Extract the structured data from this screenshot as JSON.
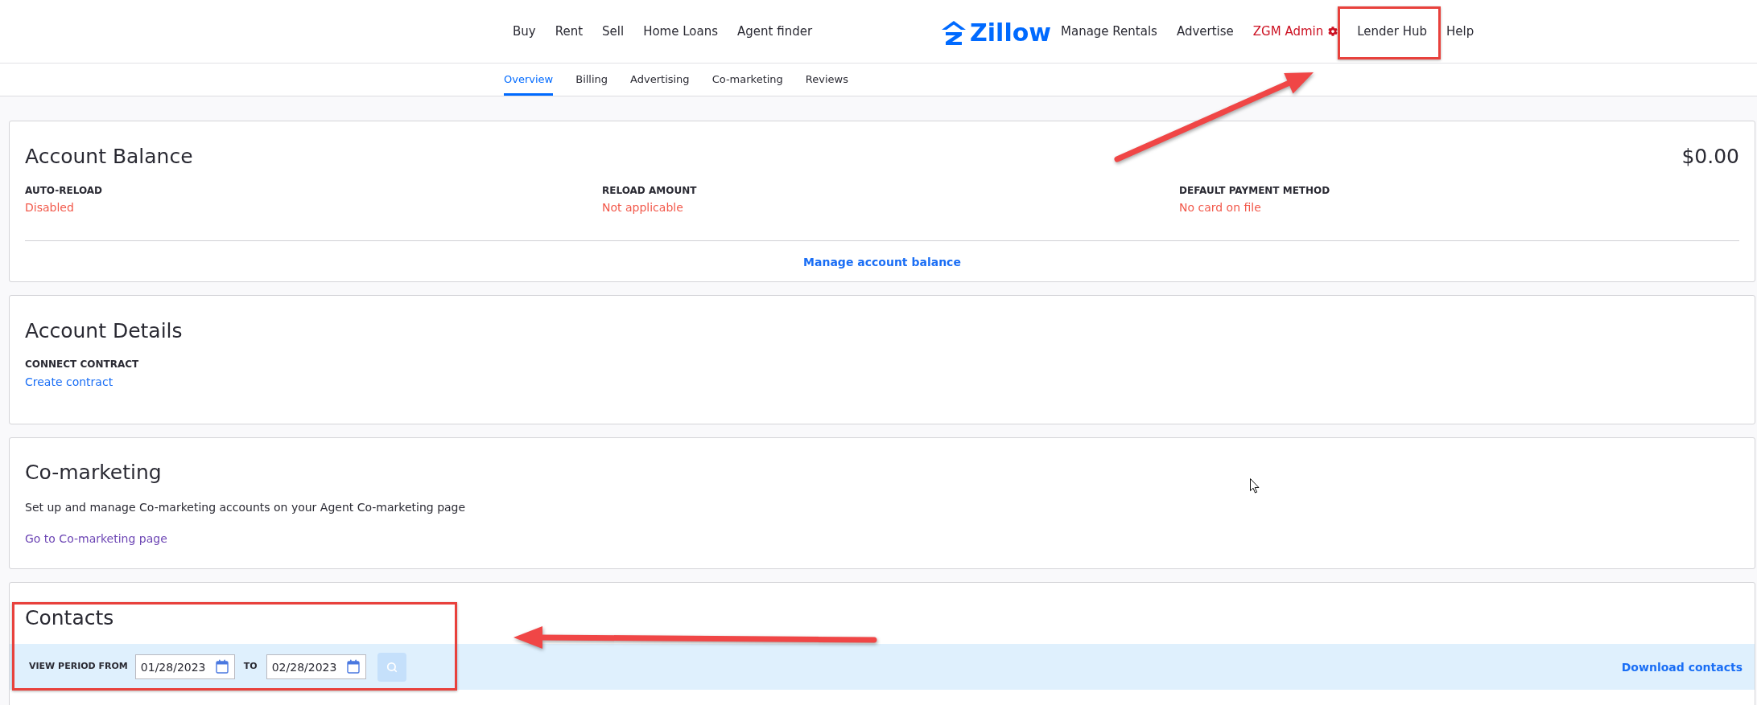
{
  "header": {
    "nav_left": [
      {
        "label": "Buy",
        "kind": "link",
        "highlighted": false
      },
      {
        "label": "Rent",
        "kind": "link",
        "highlighted": false
      },
      {
        "label": "Sell",
        "kind": "link",
        "highlighted": false
      },
      {
        "label": "Home Loans",
        "kind": "link",
        "highlighted": false
      },
      {
        "label": "Agent finder",
        "kind": "link",
        "highlighted": false
      }
    ],
    "logo": {
      "text": "Zillow"
    },
    "nav_right": [
      {
        "label": "Manage Rentals",
        "kind": "link",
        "highlighted": false
      },
      {
        "label": "Advertise",
        "kind": "link",
        "highlighted": false
      },
      {
        "label": "ZGM Admin",
        "kind": "admin",
        "highlighted": false
      },
      {
        "label": "Lender Hub",
        "kind": "link",
        "highlighted": true
      },
      {
        "label": "Help",
        "kind": "link",
        "highlighted": false
      }
    ]
  },
  "subnav": [
    {
      "label": "Overview",
      "selected": true
    },
    {
      "label": "Billing",
      "selected": false
    },
    {
      "label": "Advertising",
      "selected": false
    },
    {
      "label": "Co-marketing",
      "selected": false
    },
    {
      "label": "Reviews",
      "selected": false
    }
  ],
  "account_balance": {
    "title": "Account Balance",
    "balance": "$0.00",
    "fields": [
      {
        "label": "AUTO-RELOAD",
        "value": "Disabled"
      },
      {
        "label": "RELOAD AMOUNT",
        "value": "Not applicable"
      },
      {
        "label": "DEFAULT PAYMENT METHOD",
        "value": "No card on file"
      }
    ],
    "link": {
      "label": "Manage account balance",
      "visited": false
    }
  },
  "account_details": {
    "title": "Account Details",
    "fields": [
      {
        "label": "CONNECT CONTRACT",
        "link": {
          "label": "Create contract",
          "visited": false
        }
      }
    ]
  },
  "co_marketing": {
    "title": "Co-marketing",
    "description": "Set up and manage Co-marketing accounts on your Agent Co-marketing page",
    "link": {
      "label": "Go to Co-marketing page",
      "visited": true
    }
  },
  "contacts": {
    "title": "Contacts",
    "highlighted": true,
    "period_label": "VIEW PERIOD FROM",
    "from": "01/28/2023",
    "to_label": "TO",
    "to": "02/28/2023",
    "search_button": {
      "disabled": true
    },
    "download_link": {
      "label": "Download contacts",
      "visited": false
    }
  }
}
